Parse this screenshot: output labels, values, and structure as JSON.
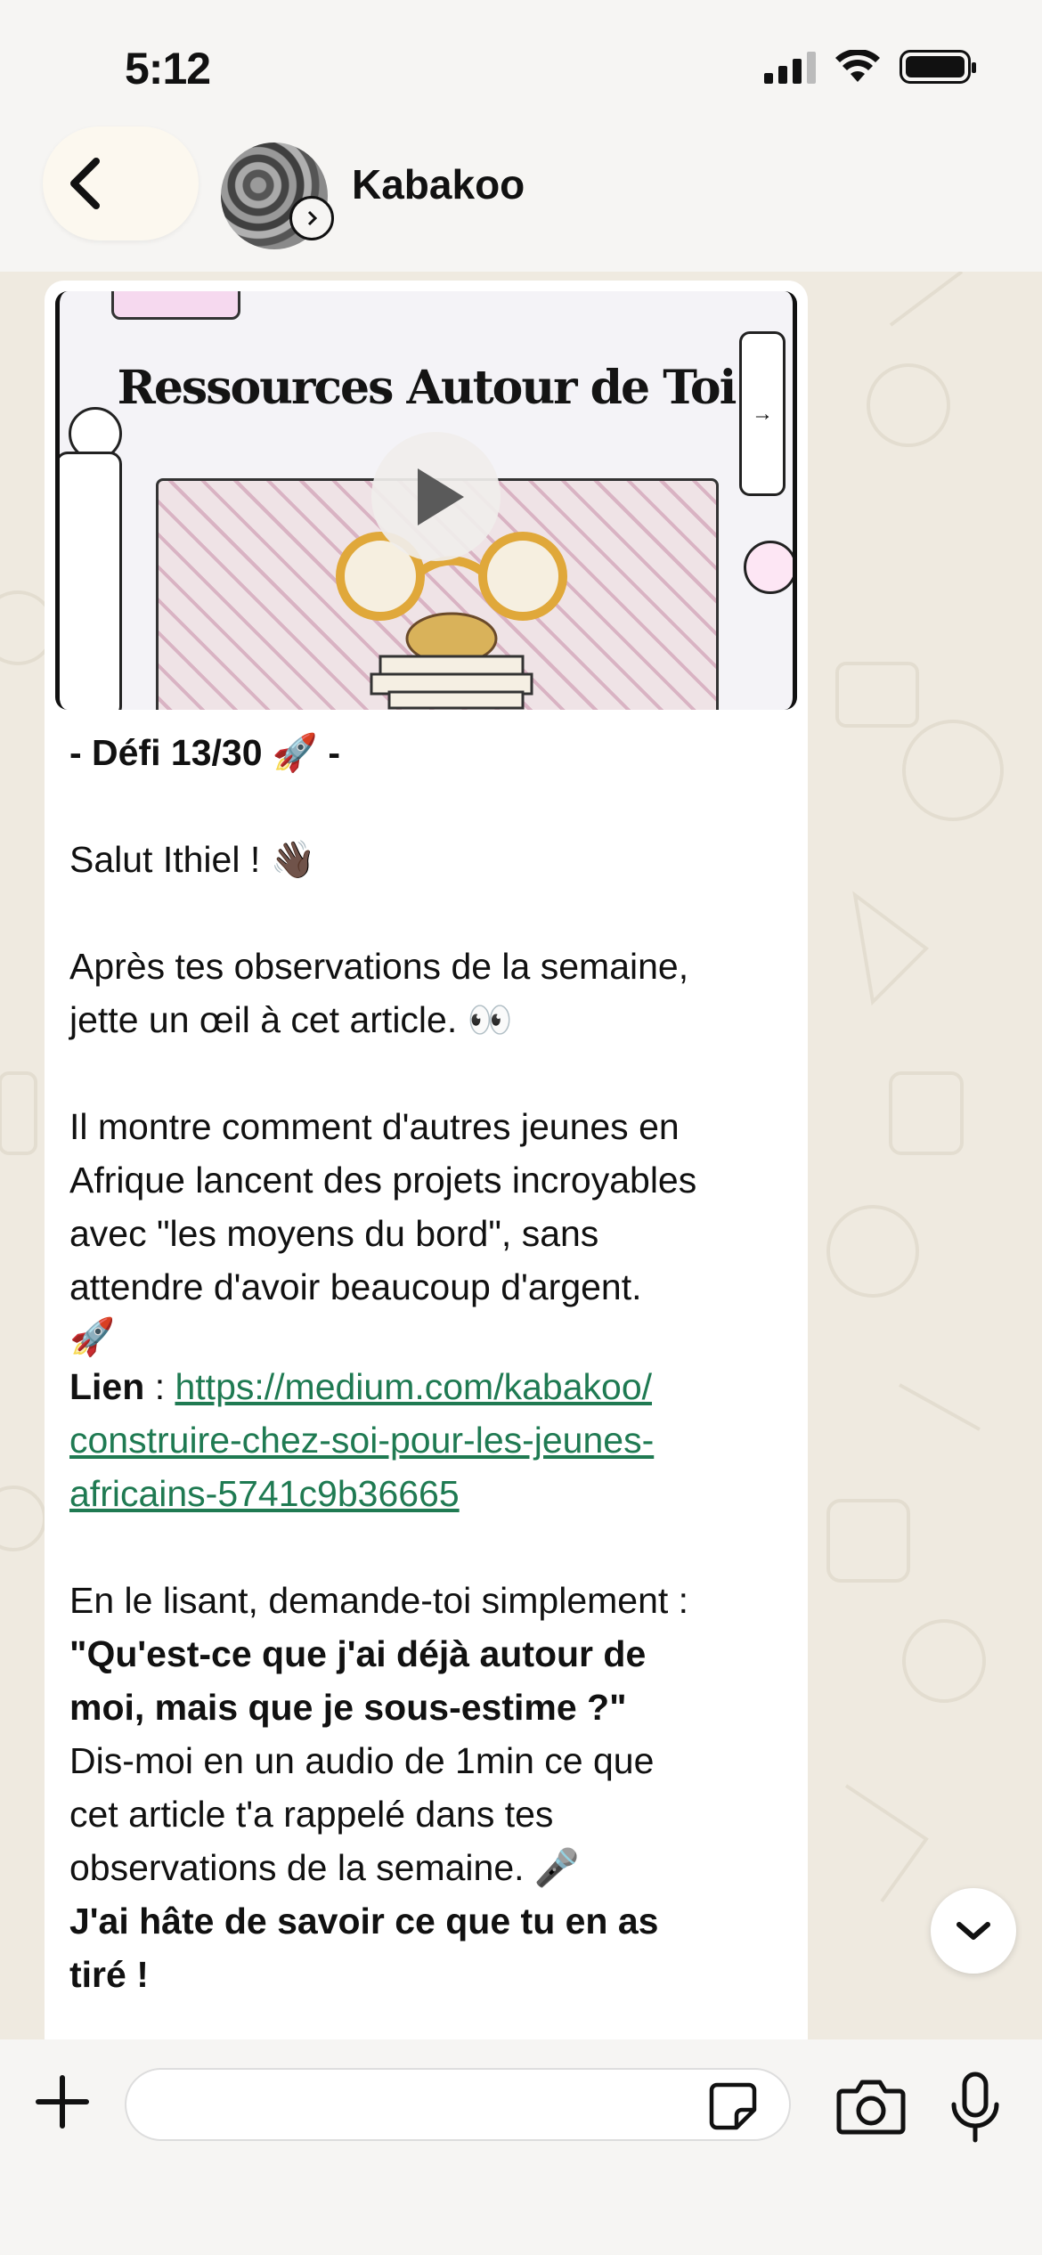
{
  "status_bar": {
    "time": "5:12"
  },
  "header": {
    "contact_name": "Kabakoo"
  },
  "message": {
    "preview_title": "Ressources Autour de Toi",
    "defi": "- Défi 13/30 🚀 -",
    "greeting": "Salut Ithiel ! 👋🏿",
    "para1_line1": "Après tes observations de la semaine,",
    "para1_line2": "jette un œil à cet article. 👀",
    "para2_line1": "Il montre comment d'autres jeunes en",
    "para2_line2": "Afrique lancent des projets incroyables",
    "para2_line3": "avec \"les moyens du bord\", sans",
    "para2_line4": "attendre d'avoir beaucoup d'argent.",
    "para2_emoji": "🚀",
    "link_label": "Lien",
    "link_sep": " : ",
    "link_line1": "https://medium.com/kabakoo/",
    "link_line2": "construire-chez-soi-pour-les-jeunes-",
    "link_line3": "africains-5741c9b36665",
    "para3_line1": "En le lisant, demande-toi simplement :",
    "para3_bold1": "\"Qu'est-ce que j'ai déjà autour de",
    "para3_bold2": "moi, mais que je sous-estime ?\"",
    "para3_line2": "Dis-moi en un audio de 1min ce que",
    "para3_line3": "cet article t'a rappelé dans tes",
    "para3_line4": "observations de la semaine. 🎤",
    "closing_line1": "J'ai hâte de savoir ce que tu en as",
    "closing_line2": "tiré !"
  },
  "composer": {
    "placeholder": ""
  },
  "colors": {
    "link": "#1f7a52",
    "chat_bg": "#efeae0",
    "bubble": "#ffffff"
  },
  "icons": [
    "back-chevron-icon",
    "contact-info-icon",
    "play-icon",
    "plus-icon",
    "sticker-icon",
    "camera-icon",
    "mic-icon",
    "chevron-down-icon"
  ]
}
